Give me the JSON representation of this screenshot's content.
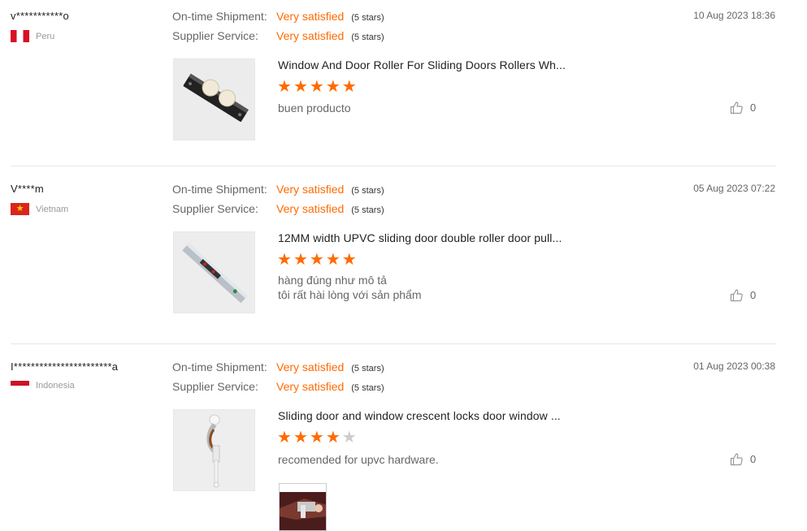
{
  "reviews": [
    {
      "user": "v***********o",
      "country": "Peru",
      "shipment_label": "On-time Shipment:",
      "shipment_value": "Very satisfied",
      "shipment_stars": "(5 stars)",
      "service_label": "Supplier Service:",
      "service_value": "Very satisfied",
      "service_stars": "(5 stars)",
      "date": "10 Aug 2023 18:36",
      "product": "Window And Door Roller For Sliding Doors Rollers Wh...",
      "rating": 5,
      "comment": "buen producto",
      "likes": "0"
    },
    {
      "user": "V****m",
      "country": "Vietnam",
      "shipment_label": "On-time Shipment:",
      "shipment_value": "Very satisfied",
      "shipment_stars": "(5 stars)",
      "service_label": "Supplier Service:",
      "service_value": "Very satisfied",
      "service_stars": "(5 stars)",
      "date": "05 Aug 2023 07:22",
      "product": "12MM width UPVC sliding door double roller door pull...",
      "rating": 5,
      "comment_lines": [
        "hàng đúng như mô tả",
        "tôi rất hài lòng với sản phẩm"
      ],
      "likes": "0"
    },
    {
      "user": "I***********************a",
      "country": "Indonesia",
      "shipment_label": "On-time Shipment:",
      "shipment_value": "Very satisfied",
      "shipment_stars": "(5 stars)",
      "service_label": "Supplier Service:",
      "service_value": "Very satisfied",
      "service_stars": "(5 stars)",
      "date": "01 Aug 2023 00:38",
      "product": "Sliding door and window crescent locks door window ...",
      "rating": 4,
      "comment": "recomended for upvc hardware.",
      "likes": "0"
    }
  ],
  "colors": {
    "accent": "#ff6a00",
    "star_off": "#cccccc",
    "divider": "#e6e6e6"
  },
  "icons": {
    "like": "thumbs-up-icon",
    "star": "star-icon"
  }
}
